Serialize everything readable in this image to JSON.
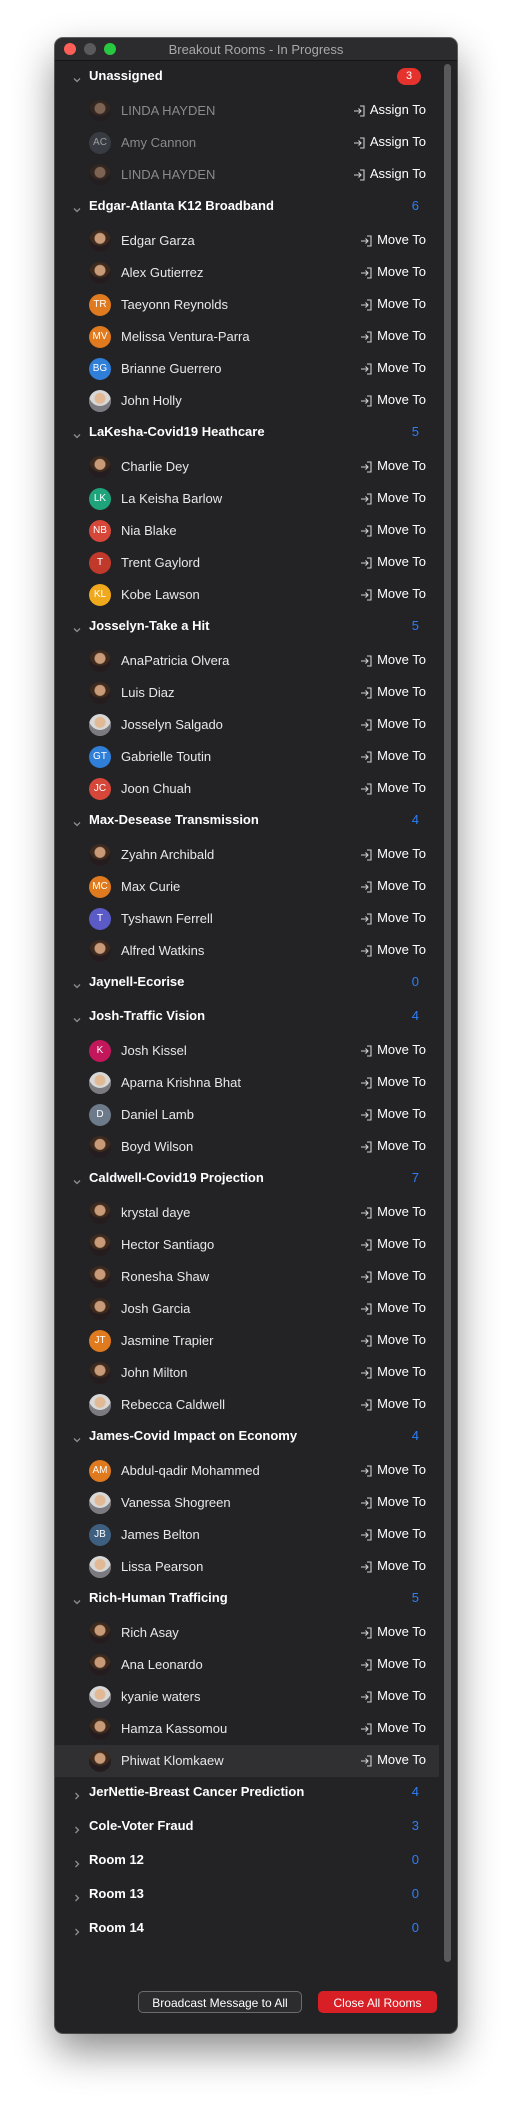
{
  "window": {
    "title": "Breakout Rooms - In Progress"
  },
  "icons": {
    "assign": "move-to-icon",
    "collapse": "chevron-down-icon",
    "expand": "chevron-right-icon"
  },
  "colors": {
    "count": "#2d7ff9",
    "badge": "#e5322d",
    "close_button": "#d81f25"
  },
  "unassigned": {
    "label": "Unassigned",
    "count": "3",
    "action_label": "Assign To",
    "participants": [
      {
        "name": "LINDA HAYDEN",
        "initials": "",
        "color": ""
      },
      {
        "name": "Amy Cannon",
        "initials": "AC",
        "color": "#4a5058"
      },
      {
        "name": "LINDA HAYDEN",
        "initials": "",
        "color": ""
      }
    ]
  },
  "move_label": "Move To",
  "rooms": [
    {
      "name": "Edgar-Atlanta K12 Broadband",
      "count": "6",
      "expanded": true,
      "participants": [
        {
          "name": "Edgar Garza",
          "initials": "",
          "color": ""
        },
        {
          "name": "Alex Gutierrez",
          "initials": "",
          "color": ""
        },
        {
          "name": "Taeyonn Reynolds",
          "initials": "TR",
          "color": "#e07a1f"
        },
        {
          "name": "Melissa Ventura-Parra",
          "initials": "MV",
          "color": "#e07a1f"
        },
        {
          "name": "Brianne Guerrero",
          "initials": "BG",
          "color": "#2f7ed8"
        },
        {
          "name": "John Holly",
          "initials": "",
          "color": ""
        }
      ]
    },
    {
      "name": "LaKesha-Covid19 Heathcare",
      "count": "5",
      "expanded": true,
      "participants": [
        {
          "name": "Charlie Dey",
          "initials": "",
          "color": ""
        },
        {
          "name": "La Keisha Barlow",
          "initials": "LK",
          "color": "#1ea37a"
        },
        {
          "name": "Nia Blake",
          "initials": "NB",
          "color": "#d6473a"
        },
        {
          "name": "Trent Gaylord",
          "initials": "T",
          "color": "#c0392b"
        },
        {
          "name": "Kobe Lawson",
          "initials": "KL",
          "color": "#f0a81c"
        }
      ]
    },
    {
      "name": "Josselyn-Take a Hit",
      "count": "5",
      "expanded": true,
      "participants": [
        {
          "name": "AnaPatricia Olvera",
          "initials": "",
          "color": ""
        },
        {
          "name": "Luis Diaz",
          "initials": "",
          "color": ""
        },
        {
          "name": "Josselyn Salgado",
          "initials": "",
          "color": ""
        },
        {
          "name": "Gabrielle Toutin",
          "initials": "GT",
          "color": "#2f7ed8"
        },
        {
          "name": "Joon Chuah",
          "initials": "JC",
          "color": "#d6473a"
        }
      ]
    },
    {
      "name": "Max-Desease Transmission",
      "count": "4",
      "expanded": true,
      "participants": [
        {
          "name": "Zyahn Archibald",
          "initials": "",
          "color": ""
        },
        {
          "name": "Max Curie",
          "initials": "MC",
          "color": "#e07a1f"
        },
        {
          "name": "Tyshawn Ferrell",
          "initials": "T",
          "color": "#5b5bc8"
        },
        {
          "name": "Alfred Watkins",
          "initials": "",
          "color": ""
        }
      ]
    },
    {
      "name": "Jaynell-Ecorise",
      "count": "0",
      "expanded": true,
      "participants": []
    },
    {
      "name": "Josh-Traffic Vision",
      "count": "4",
      "expanded": true,
      "participants": [
        {
          "name": "Josh Kissel",
          "initials": "K",
          "color": "#c2185b"
        },
        {
          "name": "Aparna Krishna Bhat",
          "initials": "",
          "color": ""
        },
        {
          "name": "Daniel Lamb",
          "initials": "D",
          "color": "#6c7a89"
        },
        {
          "name": "Boyd Wilson",
          "initials": "",
          "color": ""
        }
      ]
    },
    {
      "name": "Caldwell-Covid19 Projection",
      "count": "7",
      "expanded": true,
      "participants": [
        {
          "name": "krystal daye",
          "initials": "",
          "color": ""
        },
        {
          "name": "Hector Santiago",
          "initials": "",
          "color": ""
        },
        {
          "name": "Ronesha Shaw",
          "initials": "",
          "color": ""
        },
        {
          "name": "Josh Garcia",
          "initials": "",
          "color": ""
        },
        {
          "name": "Jasmine Trapier",
          "initials": "JT",
          "color": "#e07a1f"
        },
        {
          "name": "John Milton",
          "initials": "",
          "color": ""
        },
        {
          "name": "Rebecca Caldwell",
          "initials": "",
          "color": ""
        }
      ]
    },
    {
      "name": "James-Covid Impact on Economy",
      "count": "4",
      "expanded": true,
      "participants": [
        {
          "name": "Abdul-qadir Mohammed",
          "initials": "AM",
          "color": "#e07a1f"
        },
        {
          "name": "Vanessa Shogreen",
          "initials": "",
          "color": ""
        },
        {
          "name": "James Belton",
          "initials": "JB",
          "color": "#3f5f80"
        },
        {
          "name": "Lissa Pearson",
          "initials": "",
          "color": ""
        }
      ]
    },
    {
      "name": "Rich-Human Trafficing",
      "count": "5",
      "expanded": true,
      "participants": [
        {
          "name": "Rich Asay",
          "initials": "",
          "color": ""
        },
        {
          "name": "Ana Leonardo",
          "initials": "",
          "color": ""
        },
        {
          "name": "kyanie waters",
          "initials": "",
          "color": ""
        },
        {
          "name": "Hamza Kassomou",
          "initials": "",
          "color": ""
        },
        {
          "name": "Phiwat Klomkaew",
          "initials": "",
          "color": "",
          "selected": true
        }
      ]
    },
    {
      "name": "JerNettie-Breast Cancer Prediction",
      "count": "4",
      "expanded": false,
      "participants": []
    },
    {
      "name": "Cole-Voter Fraud",
      "count": "3",
      "expanded": false,
      "participants": []
    },
    {
      "name": "Room 12",
      "count": "0",
      "expanded": false,
      "participants": []
    },
    {
      "name": "Room 13",
      "count": "0",
      "expanded": false,
      "participants": []
    },
    {
      "name": "Room 14",
      "count": "0",
      "expanded": false,
      "participants": []
    }
  ],
  "footer": {
    "broadcast_label": "Broadcast Message to All",
    "close_label": "Close All Rooms"
  }
}
